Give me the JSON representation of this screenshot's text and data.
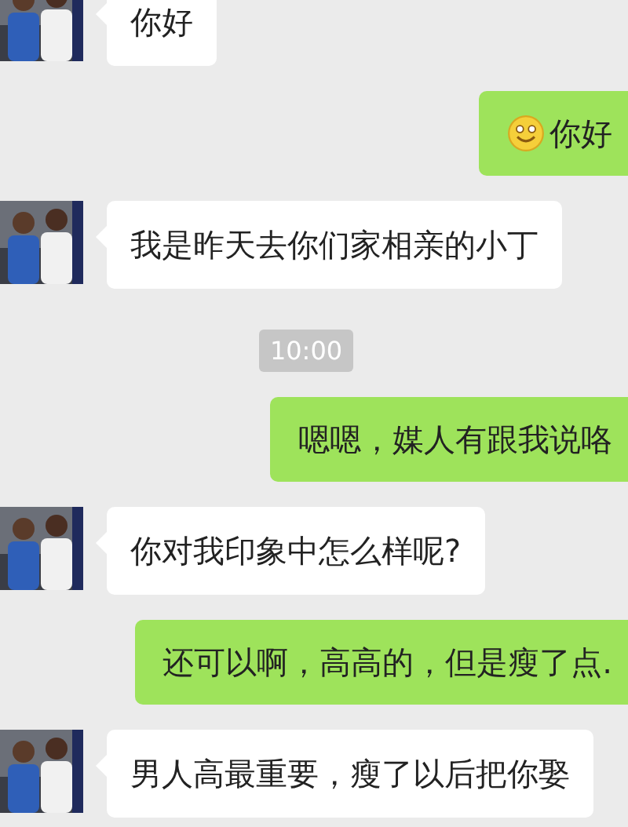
{
  "messages": [
    {
      "kind": "received",
      "text": "你好",
      "smiley": false
    },
    {
      "kind": "sent",
      "text": "你好",
      "smiley": true
    },
    {
      "kind": "received",
      "text": "我是昨天去你们家相亲的小丁",
      "smiley": false
    },
    {
      "kind": "time",
      "text": "10:00"
    },
    {
      "kind": "sent",
      "text": "嗯嗯，媒人有跟我说咯",
      "smiley": false
    },
    {
      "kind": "received",
      "text": "你对我印象中怎么样呢?",
      "smiley": false
    },
    {
      "kind": "sent",
      "text": "还可以啊，高高的，但是瘦了点.",
      "smiley": false
    },
    {
      "kind": "received",
      "text": "男人高最重要，瘦了以后把你娶",
      "smiley": false
    }
  ]
}
